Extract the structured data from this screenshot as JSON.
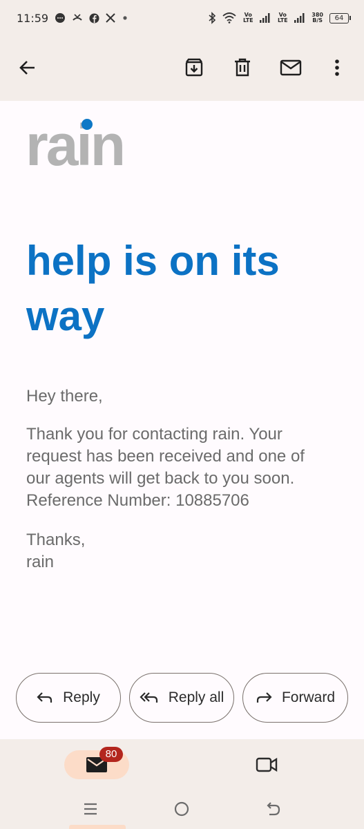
{
  "status_bar": {
    "time": "11:59",
    "network_1": "Vo LTE",
    "network_2": "Vo LTE",
    "speed": "380",
    "speed_unit": "B/S",
    "battery": "64"
  },
  "app_bar": {
    "icons": [
      "back-arrow-icon",
      "archive-icon",
      "delete-icon",
      "mark-unread-icon",
      "more-vert-icon"
    ]
  },
  "email": {
    "logo_text": "rain",
    "headline": "help is on its way",
    "greeting": "Hey there,",
    "body_lines": [
      "Thank you for contacting rain. Your",
      "request has been received and one of",
      "our agents will get back to you soon.",
      "Reference Number: 10885706"
    ],
    "signoff_1": "Thanks,",
    "signoff_2": "rain",
    "brand_colors": {
      "blue": "#0c72c4",
      "logo_grey": "#b3b3b3"
    }
  },
  "actions": {
    "reply": "Reply",
    "reply_all": "Reply all",
    "forward": "Forward"
  },
  "bottom_nav": {
    "mail_badge": "80",
    "icons": [
      "mail-icon",
      "video-icon"
    ]
  },
  "system_nav": {
    "icons": [
      "recents-icon",
      "home-icon",
      "back-icon"
    ]
  }
}
